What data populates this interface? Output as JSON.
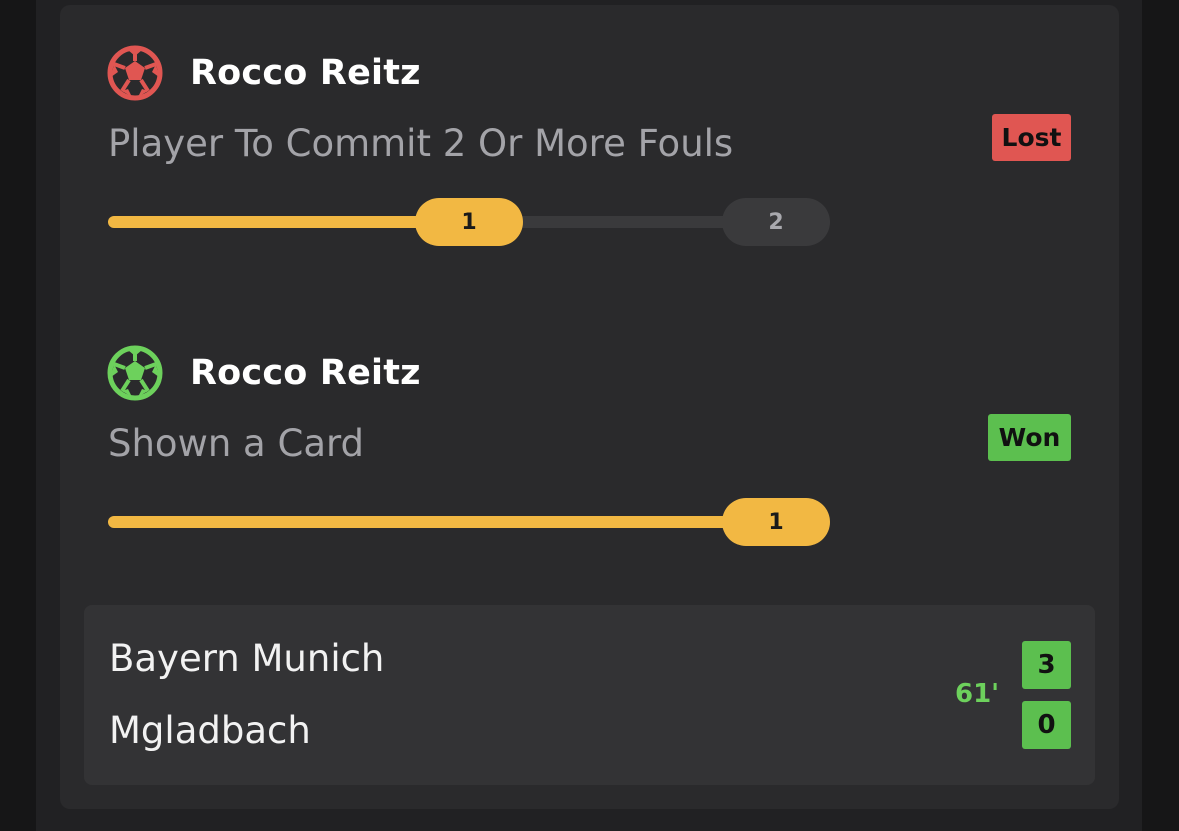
{
  "selections": [
    {
      "player": "Rocco Reitz",
      "icon": "soccer-ball-icon",
      "icon_color": "#e05652",
      "market": "Player To Commit 2 Or More Fouls",
      "result": "Lost",
      "result_color": "#e05652",
      "progress": {
        "current": "1",
        "target": "2",
        "fraction": 0.5
      }
    },
    {
      "player": "Rocco Reitz",
      "icon": "soccer-ball-icon",
      "icon_color": "#5cbf4f",
      "market": "Shown a Card",
      "result": "Won",
      "result_color": "#5cbf4f",
      "progress": {
        "current": "1",
        "target": "1",
        "fraction": 1.0
      }
    }
  ],
  "match": {
    "home_team": "Bayern Munich",
    "away_team": "Mgladbach",
    "minute": "61'",
    "home_score": "3",
    "away_score": "0"
  },
  "colors": {
    "progress_fill": "#f2b843",
    "progress_track": "#3a3a3c",
    "live_green": "#6dd15c"
  }
}
